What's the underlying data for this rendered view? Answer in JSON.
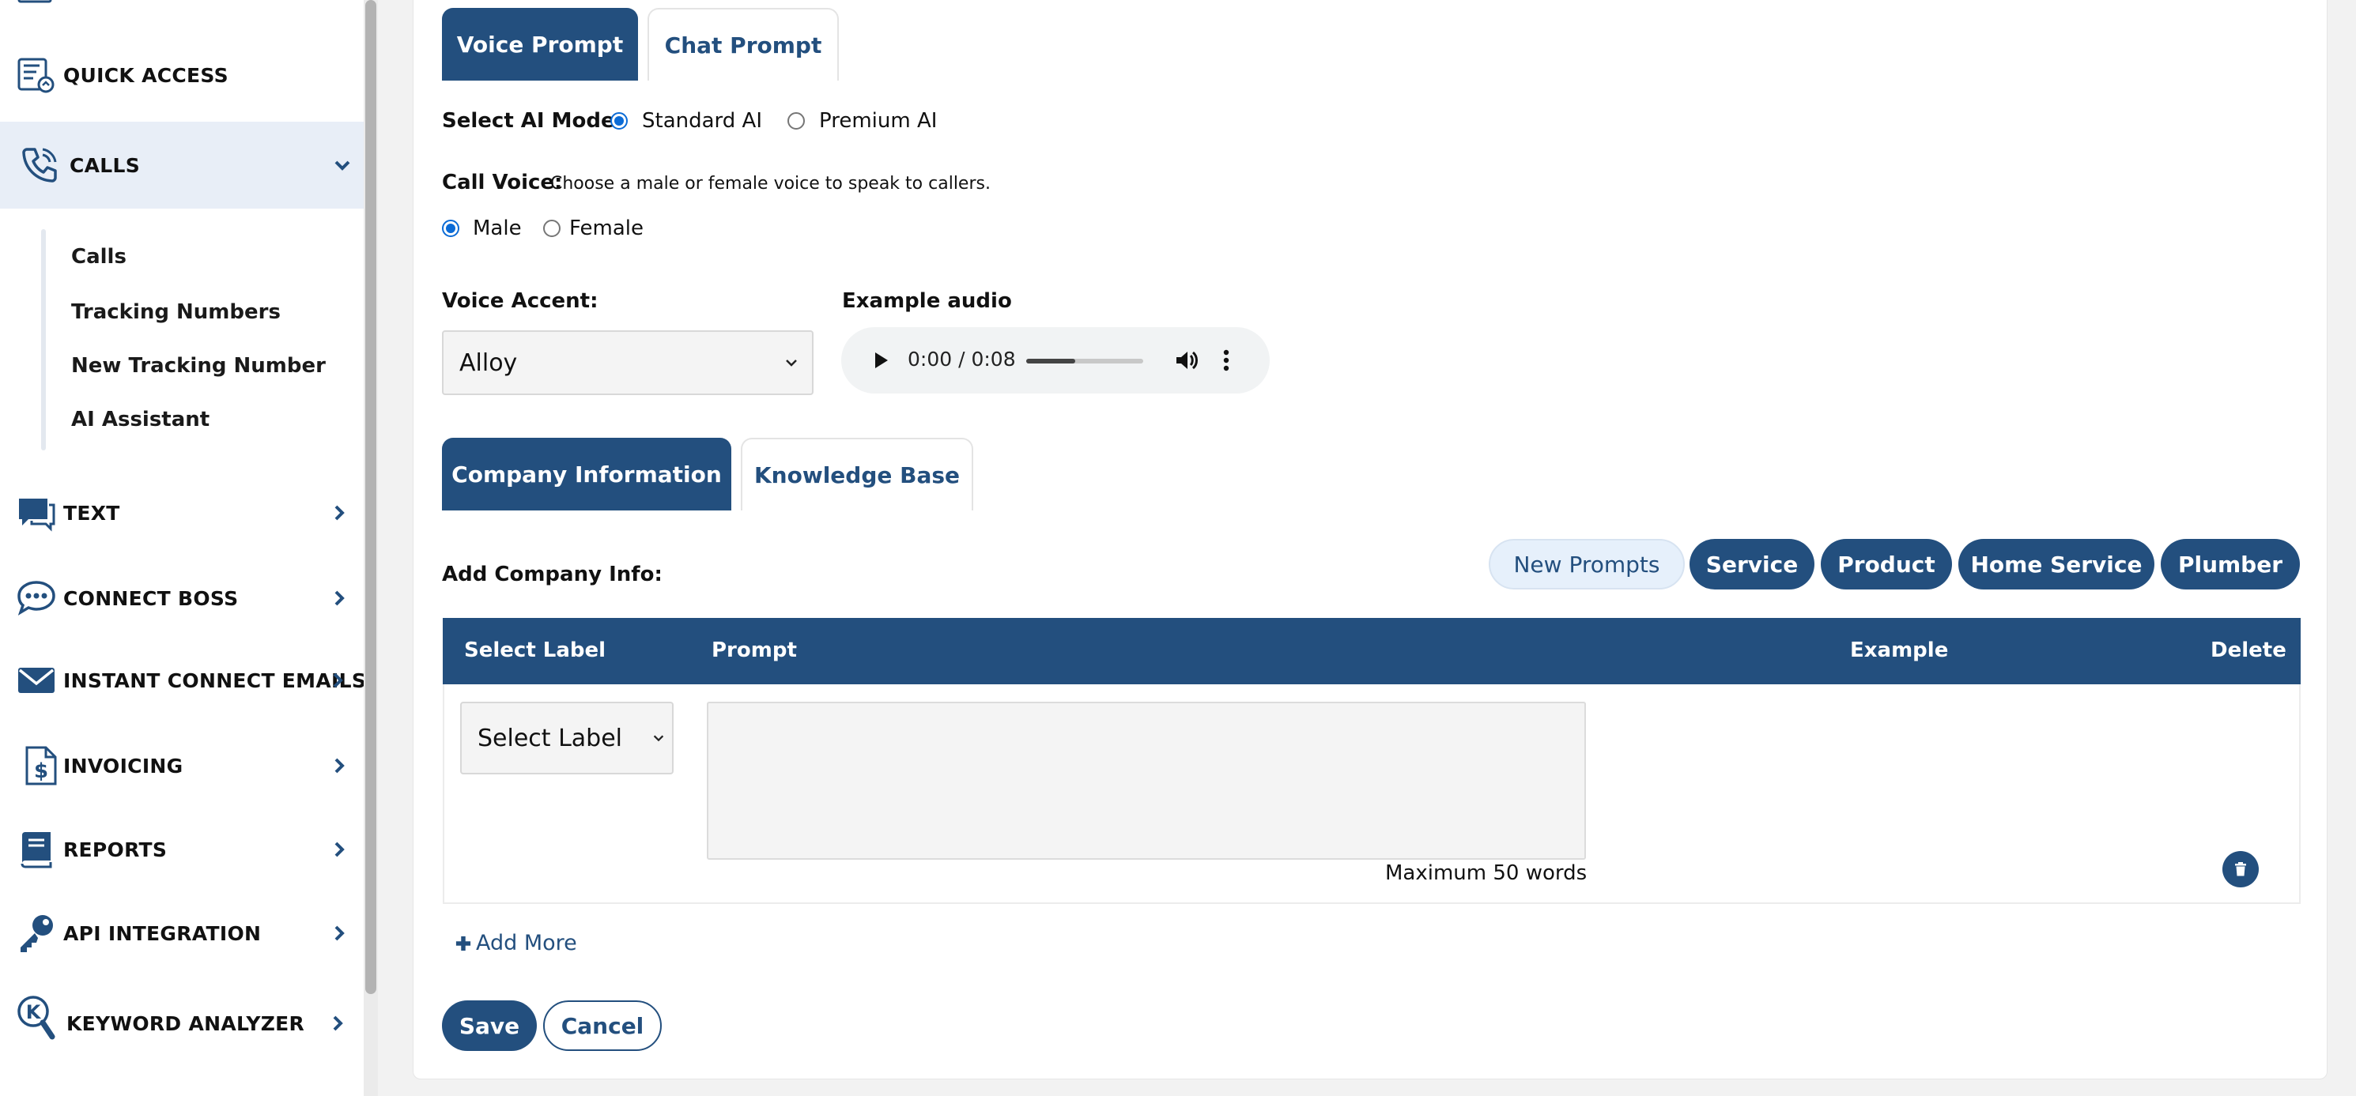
{
  "sidebar": {
    "items": [
      {
        "label": "QUICK ACCESS"
      },
      {
        "label": "CALLS"
      },
      {
        "label": "TEXT"
      },
      {
        "label": "CONNECT BOSS"
      },
      {
        "label": "INSTANT CONNECT EMAILS"
      },
      {
        "label": "INVOICING"
      },
      {
        "label": "REPORTS"
      },
      {
        "label": "API INTEGRATION"
      },
      {
        "label": "KEYWORD ANALYZER"
      }
    ],
    "calls_subitems": [
      {
        "label": "Calls"
      },
      {
        "label": "Tracking Numbers"
      },
      {
        "label": "New Tracking Number"
      },
      {
        "label": "AI Assistant"
      }
    ]
  },
  "prompt_tabs": {
    "voice": "Voice Prompt",
    "chat": "Chat Prompt"
  },
  "ai_mode": {
    "label": "Select AI Mode:",
    "options": [
      "Standard AI",
      "Premium AI"
    ],
    "selected": "Standard AI"
  },
  "call_voice": {
    "label": "Call Voice:",
    "description": "Choose a male or female voice to speak to callers.",
    "options": [
      "Male",
      "Female"
    ],
    "selected": "Male"
  },
  "voice_accent": {
    "label": "Voice Accent:",
    "value": "Alloy"
  },
  "example_audio": {
    "label": "Example audio",
    "time": "0:00 / 0:08",
    "progress": 0.42
  },
  "info_tabs": {
    "company": "Company Information",
    "knowledge": "Knowledge Base"
  },
  "company_info": {
    "label": "Add Company Info:",
    "preset_buttons": [
      "New Prompts",
      "Service",
      "Product",
      "Home Service",
      "Plumber"
    ]
  },
  "table": {
    "headers": {
      "label": "Select Label",
      "prompt": "Prompt",
      "example": "Example",
      "delete": "Delete"
    },
    "row": {
      "select_value": "Select Label",
      "prompt_value": "",
      "hint": "Maximum 50 words"
    }
  },
  "actions": {
    "add_more": "Add More",
    "save": "Save",
    "cancel": "Cancel"
  },
  "colors": {
    "primary": "#234f7e",
    "active_nav_bg": "#e8eef7",
    "radio_accent": "#0b6bd6"
  }
}
